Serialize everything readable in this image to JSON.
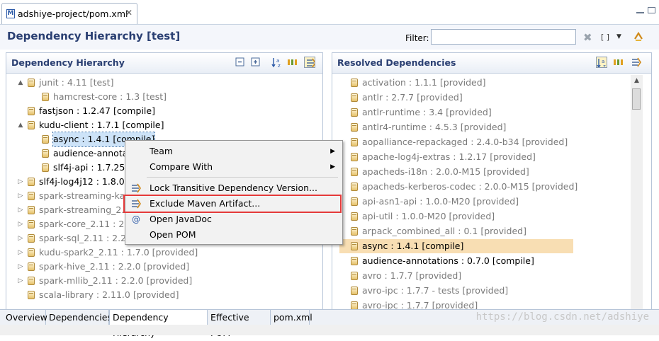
{
  "editor_tab": {
    "title": "adshiye-project/pom.xml",
    "close": "✕"
  },
  "header": {
    "title": "Dependency Hierarchy [test]",
    "filter_label": "Filter:",
    "filter_value": "",
    "bracket_toggle": "[ ]"
  },
  "left_panel": {
    "title": "Dependency Hierarchy",
    "rows": [
      {
        "indent": 0,
        "arrow": "▲",
        "name": "junit",
        "version": "4.11",
        "scope": "[test]",
        "type": "prov"
      },
      {
        "indent": 1,
        "arrow": "",
        "name": "hamcrest-core",
        "version": "1.3",
        "scope": "[test]",
        "type": "prov"
      },
      {
        "indent": 0,
        "arrow": "",
        "name": "fastjson",
        "version": "1.2.47",
        "scope": "[compile]",
        "type": "comp"
      },
      {
        "indent": 0,
        "arrow": "▲",
        "name": "kudu-client",
        "version": "1.7.1",
        "scope": "[compile]",
        "type": "comp"
      },
      {
        "indent": 1,
        "arrow": "",
        "name": "async",
        "version": "1.4.1",
        "scope": "[compile]",
        "type": "comp",
        "selected": true
      },
      {
        "indent": 1,
        "arrow": "",
        "name": "audience-annota",
        "version": "",
        "scope": "",
        "type": "comp"
      },
      {
        "indent": 1,
        "arrow": "",
        "name": "slf4j-api",
        "version": "1.7.25",
        "scope": "",
        "type": "comp"
      },
      {
        "indent": 0,
        "arrow": "▷",
        "name": "slf4j-log4j12",
        "version": "1.8.0-a",
        "scope": "",
        "type": "comp"
      },
      {
        "indent": 0,
        "arrow": "▷",
        "name": "spark-streaming-ka",
        "version": "",
        "scope": "",
        "type": "prov"
      },
      {
        "indent": 0,
        "arrow": "▷",
        "name": "spark-streaming_2.",
        "version": "",
        "scope": "",
        "type": "prov"
      },
      {
        "indent": 0,
        "arrow": "▷",
        "name": "spark-core_2.11",
        "version": "2.2.",
        "scope": "",
        "type": "prov"
      },
      {
        "indent": 0,
        "arrow": "▷",
        "name": "spark-sql_2.11",
        "version": "2.2.",
        "scope": "",
        "type": "prov"
      },
      {
        "indent": 0,
        "arrow": "▷",
        "name": "kudu-spark2_2.11",
        "version": "1.7.0",
        "scope": "[provided]",
        "type": "prov"
      },
      {
        "indent": 0,
        "arrow": "▷",
        "name": "spark-hive_2.11",
        "version": "2.2.0",
        "scope": "[provided]",
        "type": "prov"
      },
      {
        "indent": 0,
        "arrow": "▷",
        "name": "spark-mllib_2.11",
        "version": "2.2.0",
        "scope": "[provided]",
        "type": "prov"
      },
      {
        "indent": 0,
        "arrow": "",
        "name": "scala-library",
        "version": "2.11.0",
        "scope": "[provided]",
        "type": "prov"
      }
    ]
  },
  "context_menu": {
    "items": [
      {
        "label": "Team",
        "submenu": true,
        "icon": ""
      },
      {
        "label": "Compare With",
        "submenu": true,
        "icon": ""
      },
      {
        "label": "Lock Transitive Dependency Version...",
        "submenu": false,
        "icon": "lock-dependency-icon"
      },
      {
        "label": "Exclude Maven Artifact...",
        "submenu": false,
        "icon": "exclude-artifact-icon"
      },
      {
        "label": "Open JavaDoc",
        "submenu": false,
        "icon": "javadoc-icon"
      },
      {
        "label": "Open POM",
        "submenu": false,
        "icon": ""
      }
    ]
  },
  "right_panel": {
    "title": "Resolved Dependencies",
    "rows": [
      {
        "name": "activation",
        "version": "1.1.1",
        "scope": "[provided]",
        "type": "prov"
      },
      {
        "name": "antlr",
        "version": "2.7.7",
        "scope": "[provided]",
        "type": "prov"
      },
      {
        "name": "antlr-runtime",
        "version": "3.4",
        "scope": "[provided]",
        "type": "prov"
      },
      {
        "name": "antlr4-runtime",
        "version": "4.5.3",
        "scope": "[provided]",
        "type": "prov"
      },
      {
        "name": "aopalliance-repackaged",
        "version": "2.4.0-b34",
        "scope": "[provided]",
        "type": "prov"
      },
      {
        "name": "apache-log4j-extras",
        "version": "1.2.17",
        "scope": "[provided]",
        "type": "prov"
      },
      {
        "name": "apacheds-i18n",
        "version": "2.0.0-M15",
        "scope": "[provided]",
        "type": "prov"
      },
      {
        "name": "apacheds-kerberos-codec",
        "version": "2.0.0-M15",
        "scope": "[provided]",
        "type": "prov"
      },
      {
        "name": "api-asn1-api",
        "version": "1.0.0-M20",
        "scope": "[provided]",
        "type": "prov"
      },
      {
        "name": "api-util",
        "version": "1.0.0-M20",
        "scope": "[provided]",
        "type": "prov"
      },
      {
        "name": "arpack_combined_all",
        "version": "0.1",
        "scope": "[provided]",
        "type": "prov"
      },
      {
        "name": "async",
        "version": "1.4.1",
        "scope": "[compile]",
        "type": "comp",
        "highlighted": true
      },
      {
        "name": "audience-annotations",
        "version": "0.7.0",
        "scope": "[compile]",
        "type": "comp"
      },
      {
        "name": "avro",
        "version": "1.7.7",
        "scope": "[provided]",
        "type": "prov"
      },
      {
        "name": "avro-ipc",
        "version": "1.7.7 - tests",
        "scope": "[provided]",
        "type": "prov"
      },
      {
        "name": "avro-ipc",
        "version": "1.7.7",
        "scope": "[provided]",
        "type": "prov"
      }
    ]
  },
  "bottom_tabs": [
    {
      "label": "Overview",
      "active": false
    },
    {
      "label": "Dependencies",
      "active": false
    },
    {
      "label": "Dependency Hierarchy",
      "active": true
    },
    {
      "label": "Effective POM",
      "active": false
    },
    {
      "label": "pom.xml",
      "active": false
    }
  ],
  "watermark": "https://blog.csdn.net/adshiye",
  "colors": {
    "title_blue": "#2a3f72",
    "selection_bg": "#cde3f8",
    "highlight_bg": "#f8deb3",
    "callout_red": "#e53a3a"
  }
}
